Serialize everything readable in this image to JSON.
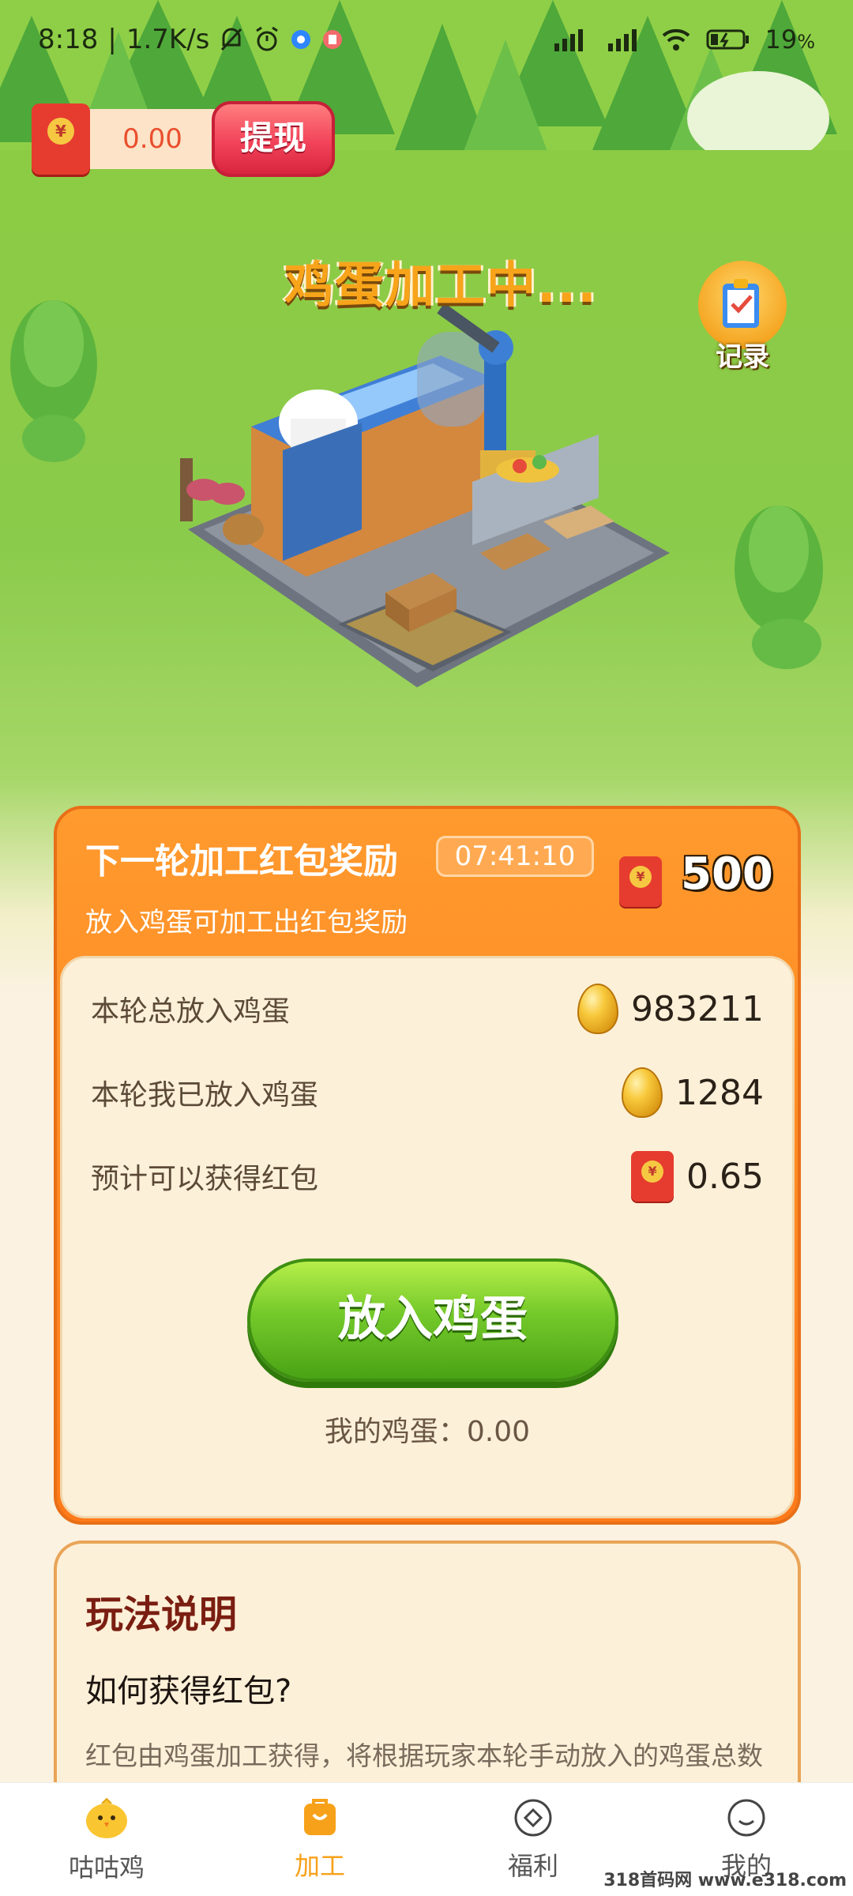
{
  "status_bar": {
    "time": "8:18",
    "speed": "1.7K/s",
    "battery": "19",
    "battery_unit": "%"
  },
  "wallet": {
    "currency_symbol": "¥",
    "amount": "0.00",
    "withdraw_label": "提现"
  },
  "scene": {
    "title": "鸡蛋加工中...",
    "record_label": "记录"
  },
  "round_card": {
    "title": "下一轮加工红包奖励",
    "timer": "07:41:10",
    "subtitle": "放入鸡蛋可加工出红包奖励",
    "reward": "500",
    "stats": [
      {
        "label": "本轮总放入鸡蛋",
        "value": "983211",
        "icon": "egg-icon"
      },
      {
        "label": "本轮我已放入鸡蛋",
        "value": "1284",
        "icon": "egg-icon"
      },
      {
        "label": "预计可以获得红包",
        "value": "0.65",
        "icon": "red-envelope-icon"
      }
    ],
    "put_egg_label": "放入鸡蛋",
    "my_eggs": "我的鸡蛋：0.00"
  },
  "rules": {
    "title": "玩法说明",
    "question": "如何获得红包?",
    "text": "红包由鸡蛋加工获得，将根据玩家本轮手动放入的鸡蛋总数"
  },
  "bottom_nav": [
    {
      "label": "咕咕鸡",
      "icon": "chick-icon",
      "active": false
    },
    {
      "label": "加工",
      "icon": "bag-icon",
      "active": true
    },
    {
      "label": "福利",
      "icon": "diamond-icon",
      "active": false
    },
    {
      "label": "我的",
      "icon": "smile-icon",
      "active": false
    }
  ],
  "watermark": "318首码网 www.e318.com",
  "colors": {
    "accent_orange": "#ff8a24",
    "button_green": "#74c92a",
    "withdraw_red": "#f2435a",
    "nav_active": "#f7a11a"
  }
}
